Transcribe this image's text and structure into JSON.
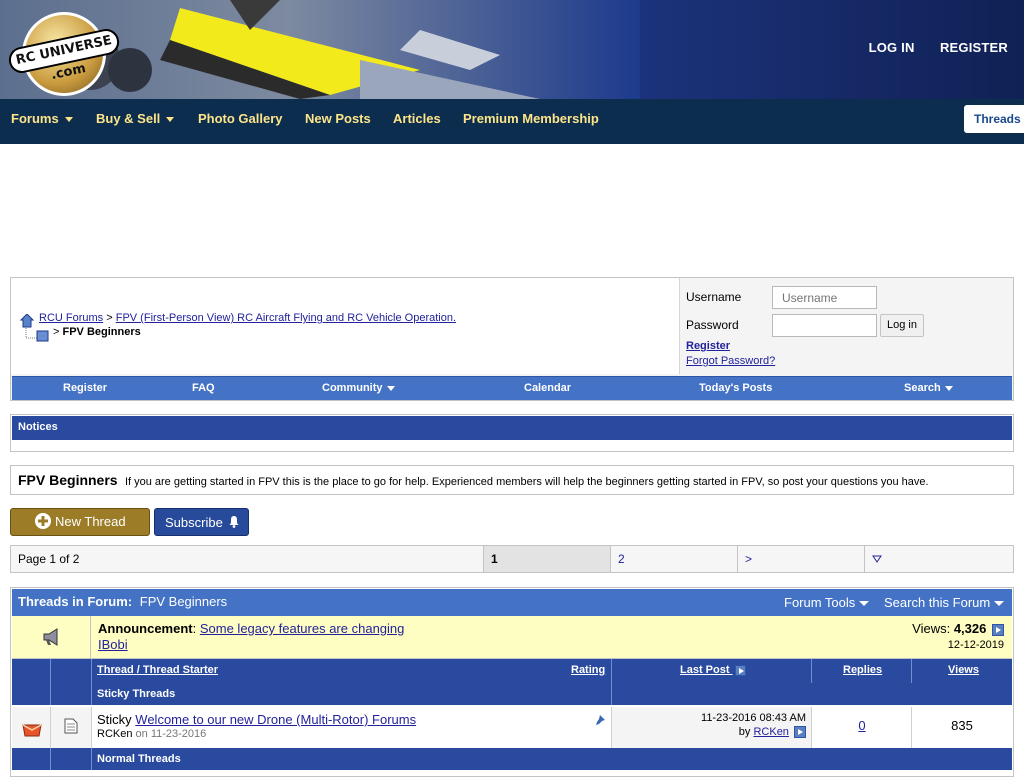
{
  "header": {
    "logo_text": "RC UNIVERSE .com",
    "login_label": "LOG IN",
    "register_label": "REGISTER"
  },
  "nav": {
    "items": [
      {
        "label": "Forums",
        "dropdown": true
      },
      {
        "label": "Buy & Sell",
        "dropdown": true
      },
      {
        "label": "Photo Gallery",
        "dropdown": false
      },
      {
        "label": "New Posts",
        "dropdown": false
      },
      {
        "label": "Articles",
        "dropdown": false
      },
      {
        "label": "Premium Membership",
        "dropdown": false
      }
    ],
    "tab_label": "Threads",
    "text_color": "#fde58a"
  },
  "breadcrumb": {
    "root": "RCU Forums",
    "sep": ">",
    "parent": "FPV (First-Person View) RC Aircraft Flying and RC Vehicle Operation.",
    "current": "FPV Beginners"
  },
  "login": {
    "username_label": "Username",
    "username_placeholder": "Username",
    "password_label": "Password",
    "button": "Log in",
    "register_link": "Register",
    "forgot_link": "Forgot Password?"
  },
  "toolbar": {
    "items": [
      "Register",
      "FAQ",
      "Community",
      "Calendar",
      "Today's Posts",
      "Search"
    ]
  },
  "notices": {
    "title": "Notices"
  },
  "forum": {
    "title": "FPV Beginners",
    "description": "If you are getting started in FPV this is the place to go for help. Experienced members will help the beginners getting started in FPV, so post your questions you have."
  },
  "buttons": {
    "new_thread": "New Thread",
    "subscribe": "Subscribe"
  },
  "pagination": {
    "info": "Page 1 of 2",
    "current": "1",
    "next_page": "2",
    "next_arrow": ">"
  },
  "threads": {
    "heading_prefix": "Threads in Forum:",
    "heading_forum": "FPV Beginners",
    "forum_tools": "Forum Tools",
    "search_forum": "Search this Forum",
    "announcement": {
      "label": "Announcement",
      "title": "Some legacy features are changing",
      "user": "IBobi",
      "views_label": "Views:",
      "views": "4,326",
      "date": "12-12-2019"
    },
    "columns": {
      "thread": "Thread",
      "slash": "/",
      "starter": "Thread Starter",
      "rating": "Rating",
      "last_post": "Last Post",
      "replies": "Replies",
      "views": "Views"
    },
    "sticky_label": "Sticky Threads",
    "normal_label": "Normal Threads",
    "rows": [
      {
        "prefix": "Sticky",
        "title": "Welcome to our new Drone (Multi-Rotor) Forums",
        "starter": "RCKen",
        "started_on": "on 11-23-2016",
        "last_post_date": "11-23-2016 08:43 AM",
        "last_post_by_label": "by",
        "last_post_user": "RCKen",
        "replies": "0",
        "views": "835"
      }
    ]
  }
}
